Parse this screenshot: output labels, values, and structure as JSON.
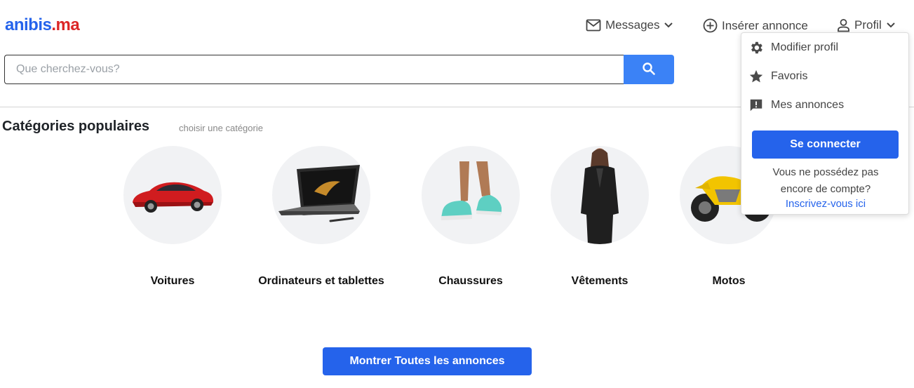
{
  "logo": {
    "part1": "anibis",
    "part2": ".ma"
  },
  "nav": {
    "messages": "Messages",
    "insert": "Insérer annonce",
    "profil": "Profil"
  },
  "search": {
    "placeholder": "Que cherchez-vous?"
  },
  "categories": {
    "title": "Catégories populaires",
    "subtitle": "choisir une catégorie",
    "items": [
      {
        "label": "Voitures",
        "icon": "car-image"
      },
      {
        "label": "Ordinateurs et tablettes",
        "icon": "laptop-image"
      },
      {
        "label": "Chaussures",
        "icon": "sneakers-image"
      },
      {
        "label": "Vêtements",
        "icon": "clothing-image"
      },
      {
        "label": "Motos",
        "icon": "motorcycle-image"
      }
    ]
  },
  "show_all": "Montrer Toutes les annonces",
  "profile_menu": {
    "items": [
      {
        "label": "Modifier profil",
        "icon": "gear-icon"
      },
      {
        "label": "Favoris",
        "icon": "star-icon"
      },
      {
        "label": "Mes annonces",
        "icon": "feedback-icon"
      }
    ],
    "login": "Se connecter",
    "note_line1": "Vous ne possédez pas",
    "note_line2": "encore de compte?",
    "register": "Inscrivez-vous ici"
  },
  "colors": {
    "brand_blue": "#2563eb",
    "brand_red": "#dc2626",
    "search_button": "#3b82f6"
  }
}
